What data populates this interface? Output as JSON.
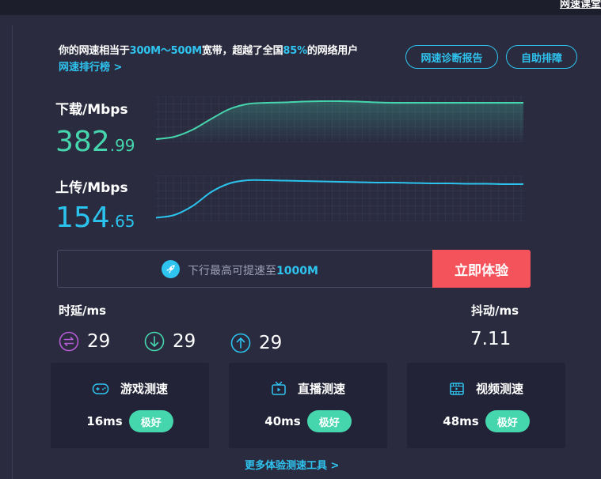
{
  "header": {
    "link": "网速课堂"
  },
  "summary": {
    "prefix": "你的网速相当于",
    "bandwidth": "300M～500M",
    "middle": "宽带，超越了全国",
    "percent": "85%",
    "suffix": "的网络用户",
    "rank_link": "网速排行榜 >"
  },
  "buttons": {
    "diagnose": "网速诊断报告",
    "self_help": "自助排障"
  },
  "download": {
    "label": "下载/Mbps",
    "int": "382",
    "dec": ".99"
  },
  "upload": {
    "label": "上传/Mbps",
    "int": "154",
    "dec": ".65"
  },
  "chart_data": [
    {
      "type": "area",
      "name": "下载",
      "values": [
        0.04,
        0.1,
        0.28,
        0.55,
        0.8,
        0.93,
        0.96,
        0.97,
        0.99,
        1.0,
        1.0,
        0.99,
        0.97,
        0.96,
        0.96,
        0.96,
        0.96,
        0.96,
        0.96,
        0.96,
        0.96
      ],
      "color": "#46d6ae"
    },
    {
      "type": "line",
      "name": "上传",
      "values": [
        0.05,
        0.12,
        0.35,
        0.7,
        0.92,
        1.0,
        1.0,
        0.99,
        0.98,
        0.97,
        0.96,
        0.95,
        0.94,
        0.94,
        0.93,
        0.92,
        0.92,
        0.91,
        0.91,
        0.9,
        0.9
      ],
      "color": "#2bc3ee"
    }
  ],
  "promo": {
    "prefix": "下行最高可提速至",
    "highlight": "1000M",
    "button": "立即体验"
  },
  "latency": {
    "label": "时延/ms",
    "ping": "29",
    "down": "29",
    "up": "29"
  },
  "jitter": {
    "label": "抖动/ms",
    "value": "7.11"
  },
  "cards": [
    {
      "title": "游戏测速",
      "ms": "16ms",
      "badge": "极好",
      "icon": "gamepad-icon"
    },
    {
      "title": "直播测速",
      "ms": "40ms",
      "badge": "极好",
      "icon": "tv-icon"
    },
    {
      "title": "视频测速",
      "ms": "48ms",
      "badge": "极好",
      "icon": "video-icon"
    }
  ],
  "more_link": "更多体验测速工具 >",
  "colors": {
    "accent": "#2fc4f0",
    "download": "#46d6ae",
    "upload": "#2bc3ee",
    "cta": "#f5535b",
    "bg": "#2a2b3f"
  }
}
